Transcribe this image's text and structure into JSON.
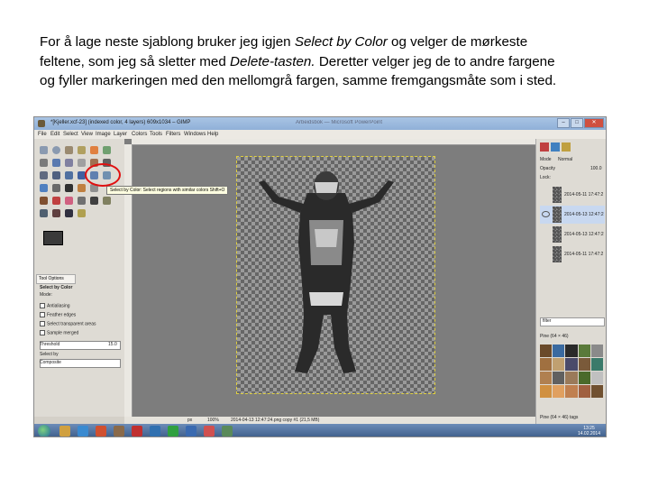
{
  "caption": {
    "l1_pre": "For å lage neste sjablong bruker jeg igjen ",
    "l1_it": "Select by Color",
    "l1_post": " og velger de mørkeste",
    "l2_pre": "feltene, som jeg så sletter med ",
    "l2_it": "Delete-tasten.",
    "l2_post": " Deretter velger jeg de to andre fargene",
    "l3": "og fyller markeringen med den mellomgrå fargen, samme fremgangsmåte som i sted."
  },
  "window": {
    "title": "*[Kjeller.xcf-23] (indexed color, 4 layers) 609x1034 – GIMP",
    "background_title": "Arbeidsbok — Microsoft PowerPoint"
  },
  "menu": [
    "File",
    "Edit",
    "Select",
    "View",
    "Image",
    "Layer",
    "Colors",
    "Tools",
    "Filters",
    "Windows",
    "Help"
  ],
  "tooltip": "Select by Color: Select regions with similar colors  Shift+O",
  "tool_options": {
    "tab": "Tool Options",
    "header": "Select by Color",
    "mode": "Mode:",
    "antialiasing": "Antialiasing",
    "feather": "Feather edges",
    "transparent": "Select transparent areas",
    "sample": "Sample merged",
    "threshold_label": "Threshold",
    "threshold_value": "15.0",
    "select_by_label": "Select by",
    "select_by_value": "Composite"
  },
  "layers_panel": {
    "mode_label": "Mode",
    "mode_value": "Normal",
    "opacity_label": "Opacity",
    "opacity_value": "100.0",
    "lock_label": "Lock:",
    "layers": [
      "2014-05-11 17:47:2",
      "2014-05-13 12:47:2",
      "2014-05-13 12:47:2",
      "2014-05-11 17:47:2"
    ]
  },
  "patterns_panel": {
    "filter": "filter",
    "title": "Pine (64 × 46)",
    "footer": "Pine (64 × 46) tags"
  },
  "statusbar": {
    "unit": "px",
    "zoom": "100%",
    "info": "2014-04-13 12:47:24.png copy #1 (21,5 MB)"
  },
  "clock": {
    "time": "13:25",
    "date": "14.02.2014"
  }
}
